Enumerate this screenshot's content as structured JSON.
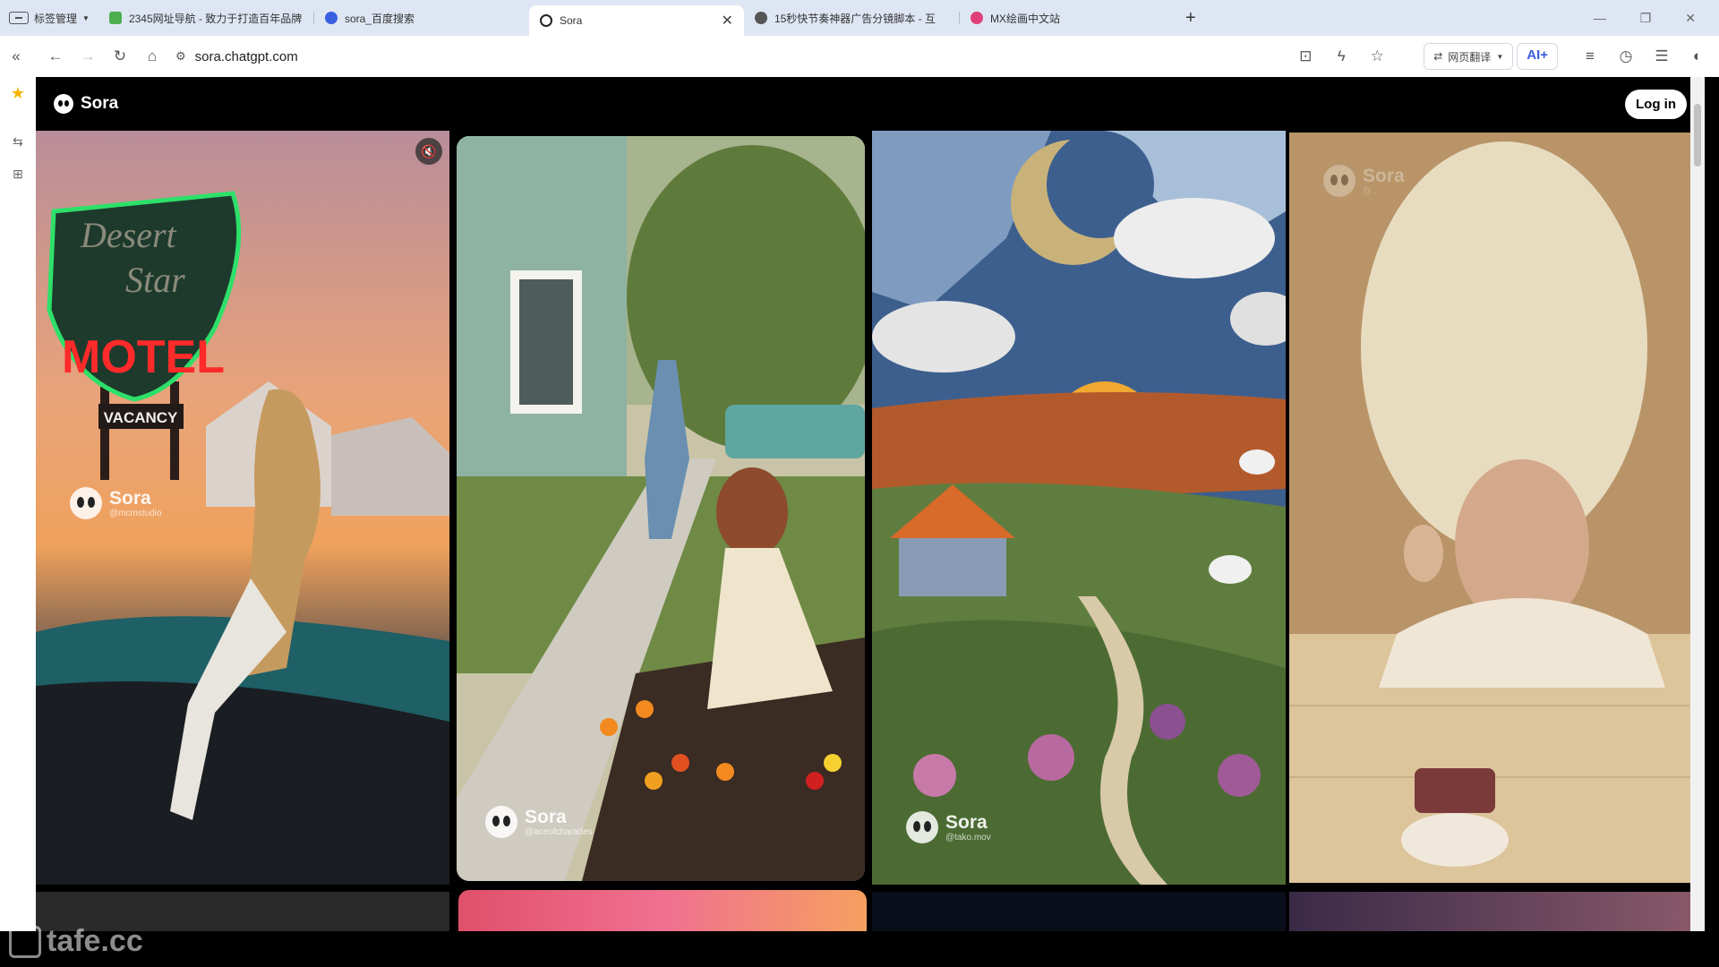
{
  "browser": {
    "tab_manager_label": "标签管理",
    "tabs": [
      {
        "label": "2345网址导航 - 致力于打造百年品牌"
      },
      {
        "label": "sora_百度搜索"
      },
      {
        "label": "Sora"
      },
      {
        "label": "15秒快节奏神器广告分镜脚本 - 互"
      },
      {
        "label": "MX绘画中文站"
      }
    ],
    "new_tab": "+",
    "address": "sora.chatgpt.com",
    "translate_label": "网页翻译",
    "ai_label": "AI+"
  },
  "page": {
    "brand": "Sora",
    "login_label": "Log in",
    "cards": [
      {
        "watermark": "Sora",
        "handle": "@mcmstudio",
        "sign_top": "Desert",
        "sign_mid": "Star",
        "sign_main": "MOTEL",
        "sign_sub": "VACANCY"
      },
      {
        "watermark": "Sora",
        "handle": "@aceofcharades"
      },
      {
        "watermark": "Sora",
        "handle": "@tako.mov"
      },
      {
        "watermark": "Sora",
        "handle": "@..."
      }
    ]
  },
  "overlay_watermark": "tafe.cc",
  "colors": {
    "accent": "#3b5bdb",
    "tabbar": "#dfe6f3"
  }
}
